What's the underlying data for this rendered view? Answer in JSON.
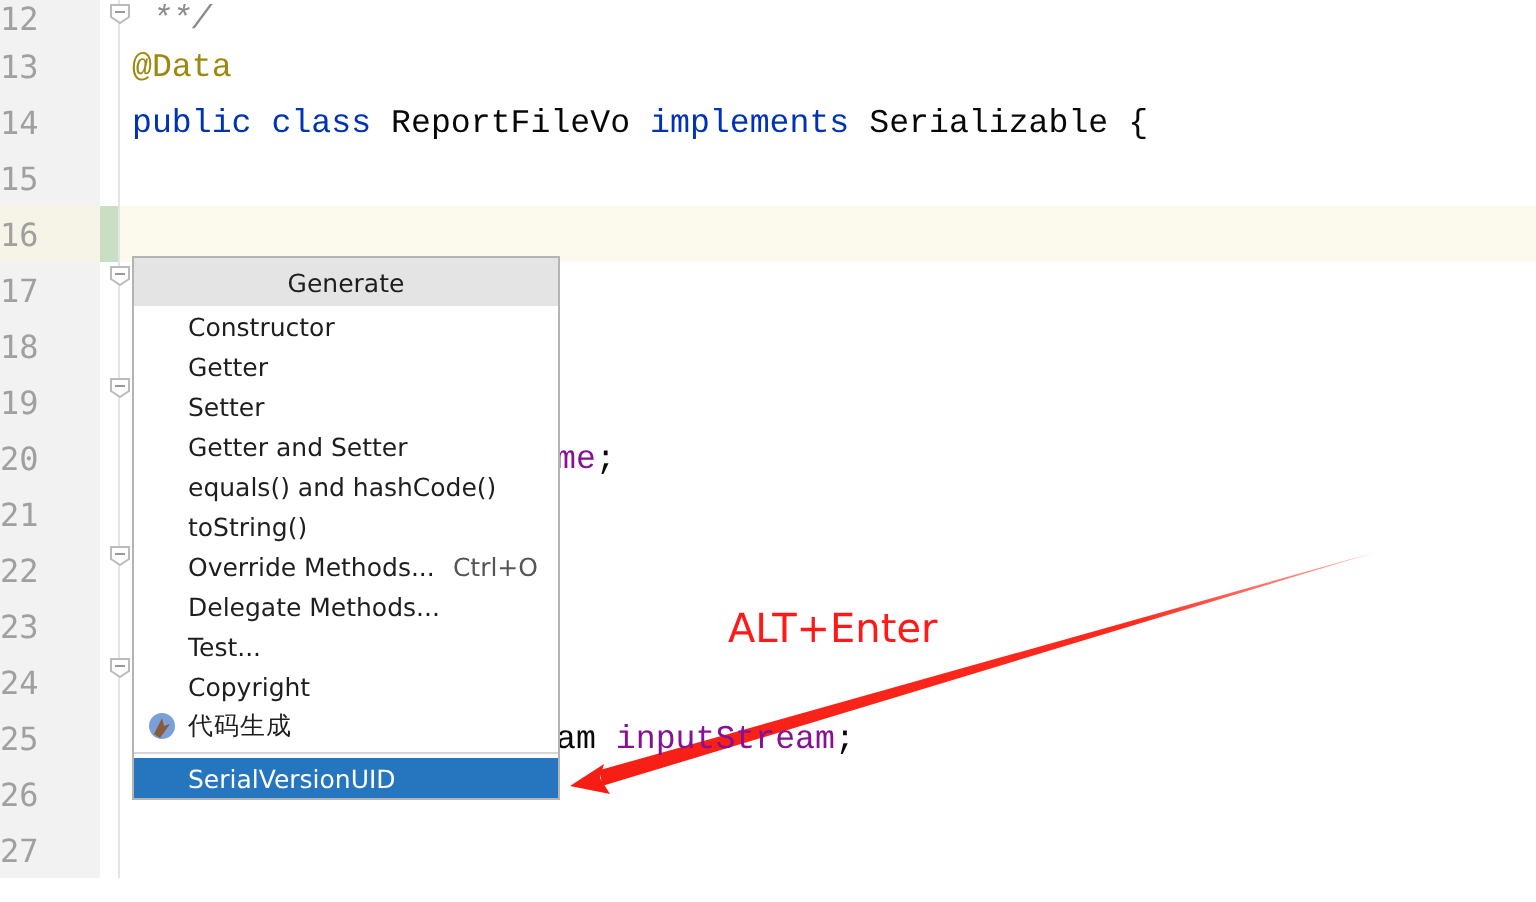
{
  "editor": {
    "lines": [
      {
        "number": "12",
        "kind": "full",
        "fold_marker": true,
        "tokens": [
          {
            "kind": "comment",
            "text": " **/"
          }
        ]
      },
      {
        "number": "13",
        "kind": "full",
        "tokens": [
          {
            "kind": "annotation",
            "text": "@Data"
          }
        ]
      },
      {
        "number": "14",
        "kind": "full",
        "tokens": [
          {
            "kind": "keyword",
            "text": "public"
          },
          {
            "kind": "keyword",
            "text": "class"
          },
          {
            "kind": "plain",
            "text": "ReportFileVo"
          },
          {
            "kind": "keyword",
            "text": "implements"
          },
          {
            "kind": "plain",
            "text": "Serializable {"
          }
        ]
      },
      {
        "number": "15",
        "kind": "full"
      },
      {
        "number": "16",
        "kind": "full",
        "current": true,
        "changed": true
      },
      {
        "number": "17",
        "kind": "full",
        "fold_marker": true
      },
      {
        "number": "18",
        "kind": "full"
      },
      {
        "number": "19",
        "kind": "full",
        "fold_marker": true
      },
      {
        "number": "20",
        "kind": "tail",
        "tokens": [
          {
            "kind": "field",
            "text": "me"
          },
          {
            "kind": "plain",
            "text": ";"
          }
        ]
      },
      {
        "number": "21",
        "kind": "full"
      },
      {
        "number": "22",
        "kind": "full",
        "fold_marker": true
      },
      {
        "number": "23",
        "kind": "full"
      },
      {
        "number": "24",
        "kind": "full",
        "fold_marker": true
      },
      {
        "number": "25",
        "kind": "tail",
        "tokens": [
          {
            "kind": "plain",
            "text": "am"
          },
          {
            "kind": "field",
            "text": "inputStream"
          },
          {
            "kind": "plain",
            "text": ";"
          }
        ]
      },
      {
        "number": "26",
        "kind": "full"
      },
      {
        "number": "27",
        "kind": "full"
      }
    ]
  },
  "popup": {
    "title": "Generate",
    "items": [
      {
        "label": "Constructor",
        "selected": false
      },
      {
        "label": "Getter",
        "selected": false
      },
      {
        "label": "Setter",
        "selected": false
      },
      {
        "label": "Getter and Setter",
        "selected": false
      },
      {
        "label": "equals() and hashCode()",
        "selected": false
      },
      {
        "label": "toString()",
        "selected": false
      },
      {
        "label": "Override Methods...",
        "shortcut": "Ctrl+O",
        "selected": false
      },
      {
        "label": "Delegate Methods...",
        "selected": false
      },
      {
        "label": "Test...",
        "selected": false
      },
      {
        "label": "Copyright",
        "selected": false
      },
      {
        "label": "代码生成",
        "kind": "plugin",
        "selected": false
      },
      {
        "label": "SerialVersionUID",
        "separator_before": true,
        "selected": true
      }
    ]
  },
  "annotation": {
    "label": "ALT+Enter"
  }
}
